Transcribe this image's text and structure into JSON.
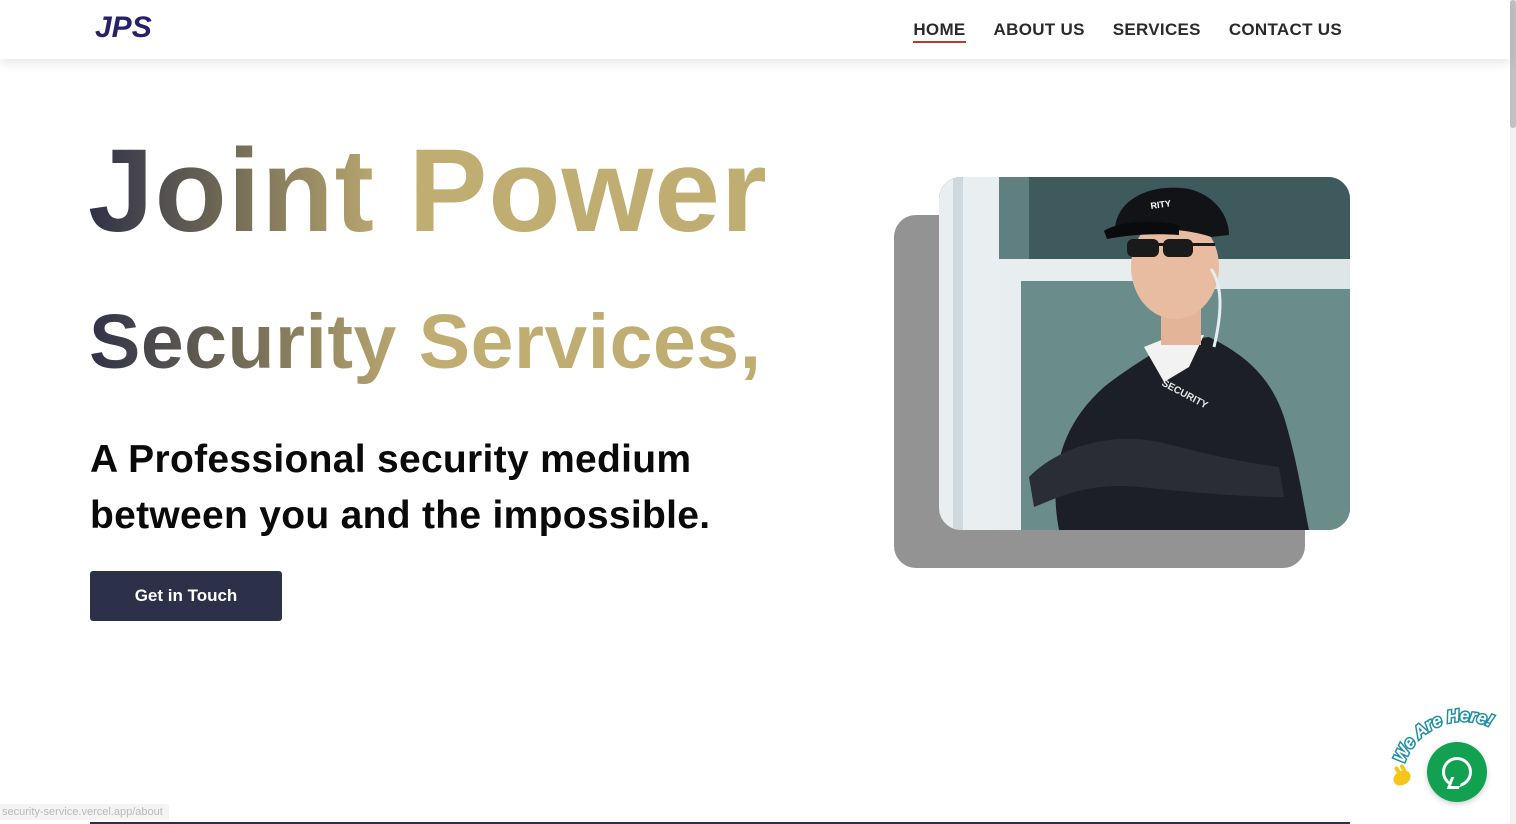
{
  "brand": {
    "logo_text": "JPS"
  },
  "nav": {
    "items": [
      {
        "label": "HOME",
        "active": true
      },
      {
        "label": "ABOUT US",
        "active": false
      },
      {
        "label": "SERVICES",
        "active": false
      },
      {
        "label": "CONTACT US",
        "active": false
      }
    ]
  },
  "hero": {
    "title_line1_a": "Joint",
    "title_line1_b": "Power",
    "title_line2_a": "Security",
    "title_line2_b": "Services,",
    "tagline": "A Professional security medium between you and the impossible.",
    "cta_label": "Get in Touch"
  },
  "photo": {
    "cap_text": "RITY",
    "jacket_text": "SECURITY"
  },
  "chat_widget": {
    "badge_text": "We Are Here!"
  },
  "status_bar": {
    "url": "security-service.vercel.app/about"
  },
  "colors": {
    "navy": "#2c3048",
    "gold": "#bfad72",
    "chat_green": "#12a150",
    "active_underline": "#c0392b"
  }
}
